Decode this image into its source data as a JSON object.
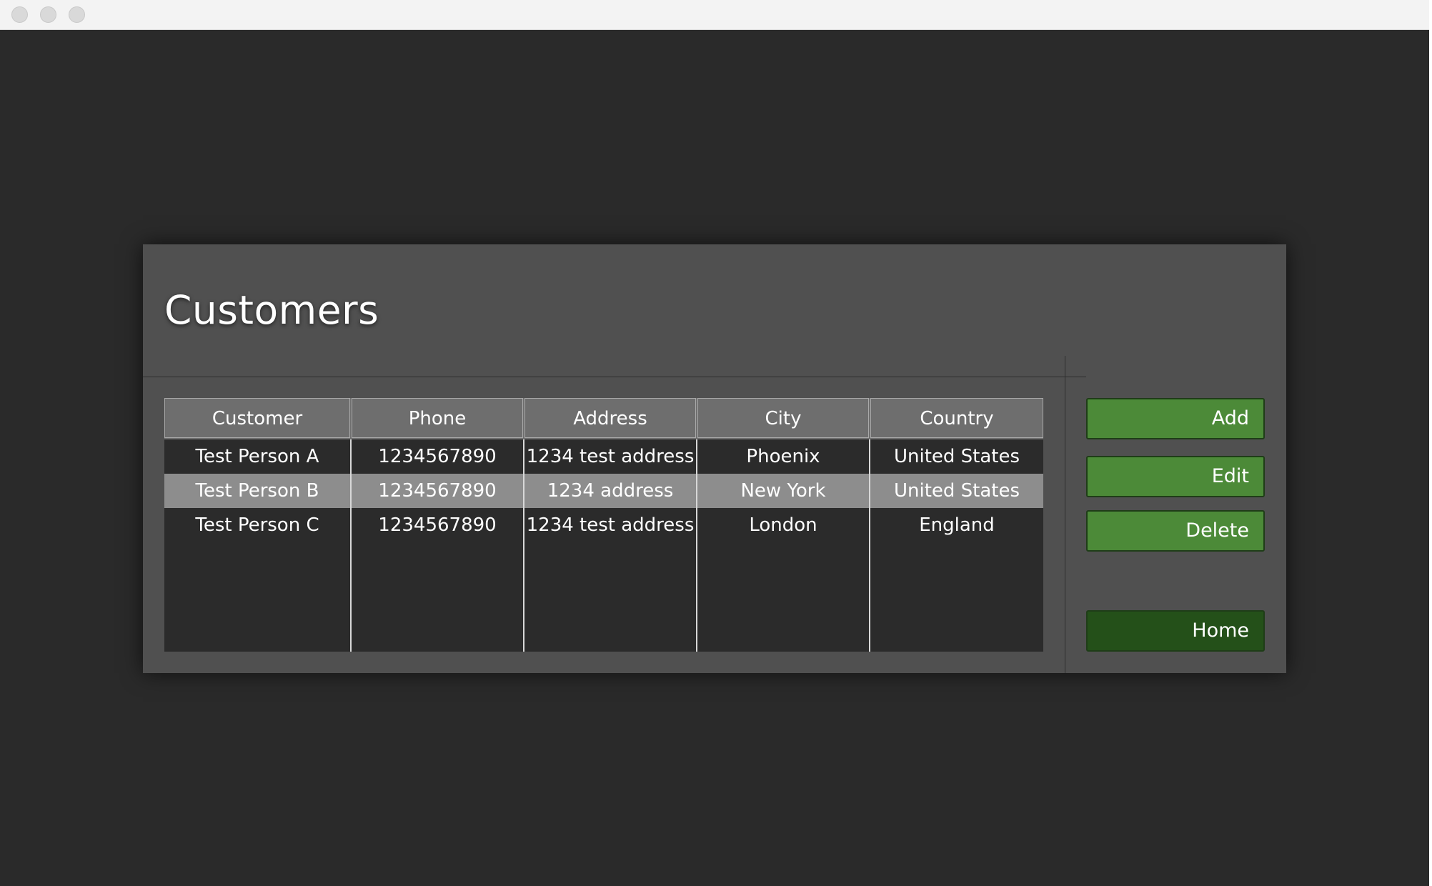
{
  "window": {
    "title": ""
  },
  "panel": {
    "title": "Customers"
  },
  "table": {
    "columns": [
      "Customer",
      "Phone",
      "Address",
      "City",
      "Country"
    ],
    "rows": [
      {
        "customer": "Test Person A",
        "phone": "1234567890",
        "address": "1234 test address",
        "city": "Phoenix",
        "country": "United States"
      },
      {
        "customer": "Test Person B",
        "phone": "1234567890",
        "address": "1234 address",
        "city": "New York",
        "country": "United States"
      },
      {
        "customer": "Test Person C",
        "phone": "1234567890",
        "address": "1234 test address",
        "city": "London",
        "country": "England"
      }
    ],
    "selected_row": 1
  },
  "actions": {
    "add_label": "Add",
    "edit_label": "Edit",
    "delete_label": "Delete",
    "home_label": "Home"
  },
  "colors": {
    "background": "#2a2a2a",
    "panel": "#505050",
    "button_green": "#4c8a38",
    "button_home": "#245019",
    "header": "#6e6e6e",
    "selected_row": "#8d8d8d"
  }
}
